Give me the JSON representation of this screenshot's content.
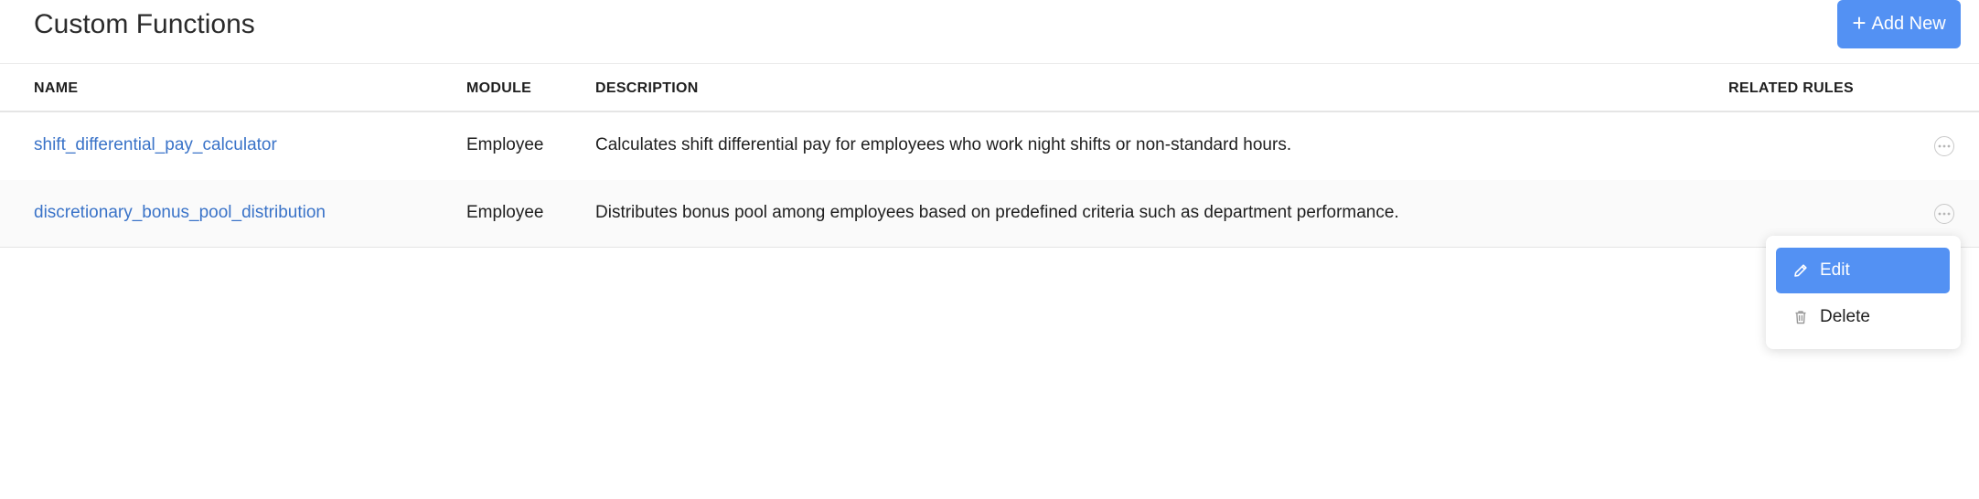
{
  "header": {
    "title": "Custom Functions",
    "add_button_label": "Add New",
    "add_button_icon": "plus-icon"
  },
  "table": {
    "columns": [
      "NAME",
      "MODULE",
      "DESCRIPTION",
      "RELATED RULES"
    ],
    "rows": [
      {
        "name": "shift_differential_pay_calculator",
        "module": "Employee",
        "description": "Calculates shift differential pay for employees who work night shifts or non-standard hours.",
        "related_rules": ""
      },
      {
        "name": "discretionary_bonus_pool_distribution",
        "module": "Employee",
        "description": "Distributes bonus pool among employees based on predefined criteria such as department performance.",
        "related_rules": ""
      }
    ]
  },
  "context_menu": {
    "items": [
      {
        "label": "Edit",
        "icon": "pencil-icon",
        "highlighted": true
      },
      {
        "label": "Delete",
        "icon": "trash-icon",
        "highlighted": false
      }
    ]
  },
  "colors": {
    "accent": "#5391f3",
    "link": "#3a73c8"
  }
}
